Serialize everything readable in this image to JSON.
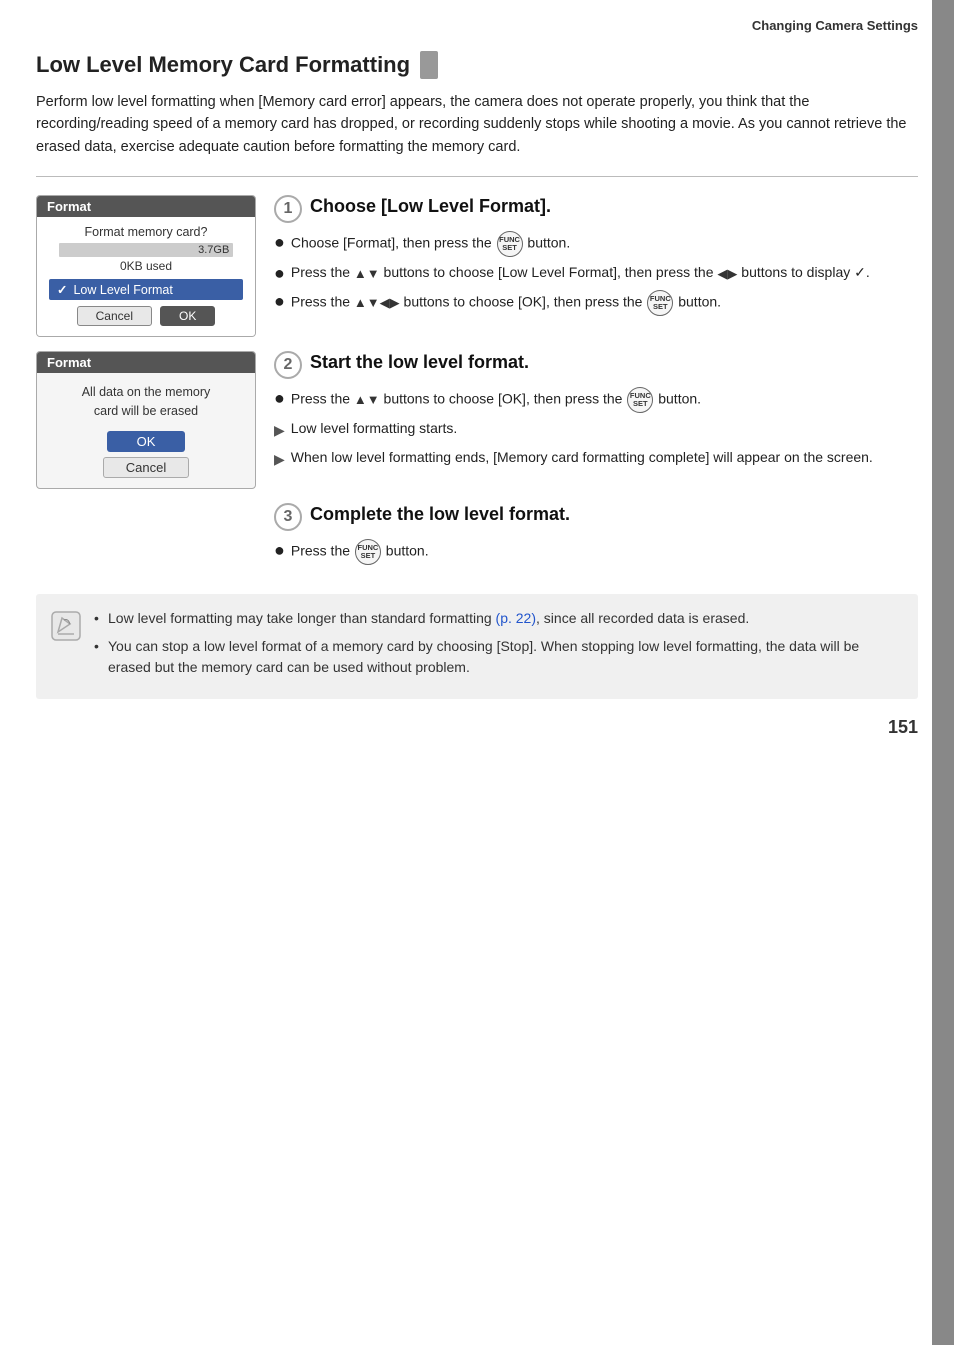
{
  "header": {
    "text": "Changing Camera Settings"
  },
  "title": "Low Level Memory Card Formatting",
  "intro": "Perform low level formatting when [Memory card error] appears, the camera does not operate properly, you think that the recording/reading speed of a memory card has dropped, or recording suddenly stops while shooting a movie. As you cannot retrieve the erased data, exercise adequate caution before formatting the memory card.",
  "steps": [
    {
      "number": "1",
      "heading": "Choose [Low Level Format].",
      "screen": {
        "title": "Format",
        "label": "Format memory card?",
        "size": "3.7GB",
        "used": "0KB used",
        "option": "Low Level Format",
        "cancel_btn": "Cancel",
        "ok_btn": "OK"
      },
      "bullets": [
        {
          "type": "dot",
          "text": "Choose [Format], then press the  button."
        },
        {
          "type": "dot",
          "text": "Press the ▲▼ buttons to choose [Low Level Format], then press the ◀▶ buttons to display ✓."
        },
        {
          "type": "dot",
          "text": "Press the ▲▼◀▶ buttons to choose [OK], then press the  button."
        }
      ]
    },
    {
      "number": "2",
      "heading": "Start the low level format.",
      "screen": {
        "title": "Format",
        "line1": "All data on the memory",
        "line2": "card will be erased",
        "ok_btn": "OK",
        "cancel_btn": "Cancel"
      },
      "bullets": [
        {
          "type": "dot",
          "text": "Press the ▲▼ buttons to choose [OK], then press the  button."
        },
        {
          "type": "arrow",
          "text": "Low level formatting starts."
        },
        {
          "type": "arrow",
          "text": "When low level formatting ends, [Memory card formatting complete] will appear on the screen."
        }
      ]
    },
    {
      "number": "3",
      "heading": "Complete the low level format.",
      "bullets": [
        {
          "type": "dot",
          "text": "Press the  button."
        }
      ]
    }
  ],
  "notes": [
    {
      "text": "Low level formatting may take longer than standard formatting",
      "link": "(p. 22)",
      "suffix": ", since all recorded data is erased."
    },
    {
      "text": "You can stop a low level format of a memory card by choosing [Stop]. When stopping low level formatting, the data will be erased but the memory card can be used without problem."
    }
  ],
  "page_number": "151"
}
